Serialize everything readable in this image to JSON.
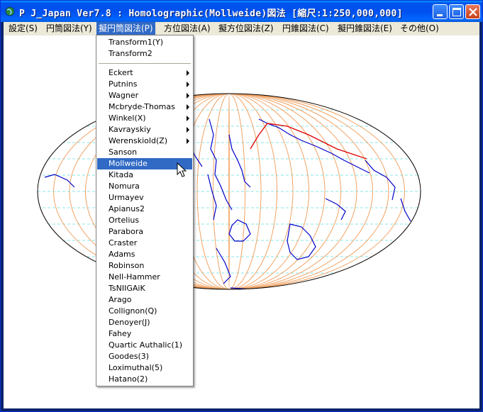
{
  "window": {
    "title": "P J_Japan  Ver7.8 : Homolographic(Mollweide)図法    [縮尺:1:250,000,000]"
  },
  "menubar": [
    {
      "label": "設定(S)"
    },
    {
      "label": "円筒図法(Y)"
    },
    {
      "label": "擬円筒図法(P)"
    },
    {
      "label": "方位図法(A)"
    },
    {
      "label": "擬方位図法(Z)"
    },
    {
      "label": "円錐図法(C)"
    },
    {
      "label": "擬円錐図法(E)"
    },
    {
      "label": "その他(O)"
    }
  ],
  "dropdown": {
    "top_items": [
      {
        "label": "Transform1(Y)"
      },
      {
        "label": "Transform2"
      }
    ],
    "items": [
      {
        "label": "Eckert",
        "submenu": true
      },
      {
        "label": "Putnins",
        "submenu": true
      },
      {
        "label": "Wagner",
        "submenu": true
      },
      {
        "label": "Mcbryde-Thomas",
        "submenu": true
      },
      {
        "label": "Winkel(X)",
        "submenu": true
      },
      {
        "label": "Kavrayskiy",
        "submenu": true
      },
      {
        "label": "Werenskiold(Z)",
        "submenu": true
      },
      {
        "label": "Sanson",
        "submenu": false
      },
      {
        "label": "Mollweide",
        "submenu": false,
        "selected": true
      },
      {
        "label": "Kitada",
        "submenu": false
      },
      {
        "label": "Nomura",
        "submenu": false
      },
      {
        "label": "Urmayev",
        "submenu": false
      },
      {
        "label": "Apianus2",
        "submenu": false
      },
      {
        "label": "Ortelius",
        "submenu": false
      },
      {
        "label": "Parabora",
        "submenu": false
      },
      {
        "label": "Craster",
        "submenu": false
      },
      {
        "label": "Adams",
        "submenu": false
      },
      {
        "label": "Robinson",
        "submenu": false
      },
      {
        "label": "Nell-Hammer",
        "submenu": false
      },
      {
        "label": "TsNIIGAiK",
        "submenu": false
      },
      {
        "label": "Arago",
        "submenu": false
      },
      {
        "label": "Collignon(Q)",
        "submenu": false
      },
      {
        "label": "Denoyer(J)",
        "submenu": false
      },
      {
        "label": "Fahey",
        "submenu": false
      },
      {
        "label": "Quartic Authalic(1)",
        "submenu": false
      },
      {
        "label": "Goodes(3)",
        "submenu": false
      },
      {
        "label": "Loximuthal(5)",
        "submenu": false
      },
      {
        "label": "Hatano(2)",
        "submenu": false
      }
    ]
  },
  "map": {
    "projection_shape": "ellipse",
    "meridian_color": "#f0a060",
    "parallel_color": "#66dddd",
    "coastline_color": "#0000cc",
    "route_color": "#dd0000"
  }
}
